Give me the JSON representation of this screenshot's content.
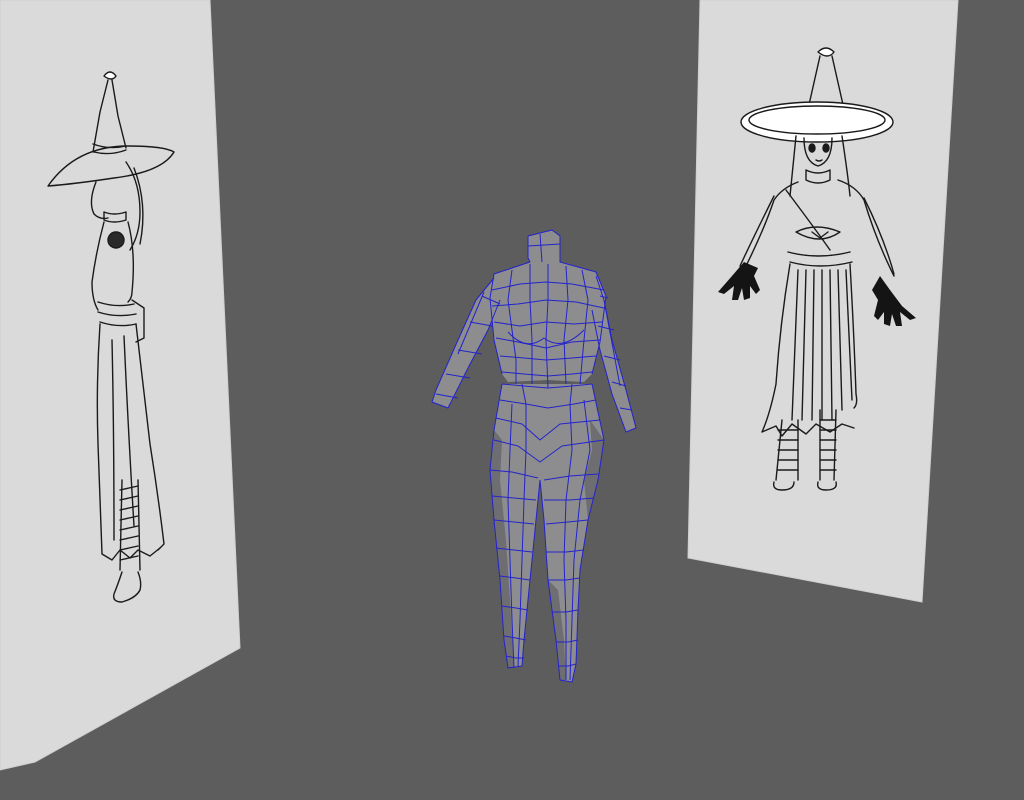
{
  "viewport": {
    "background": "#5d5d5d",
    "plane_color": "#dadada",
    "plane_edge_color": "#e6e6e6",
    "mesh_fill": "#8d8d8f",
    "mesh_shadow": "#6f6f73",
    "wireframe_color": "#1e1ed2",
    "sketch_ink": "#1a1a1a"
  },
  "scene": {
    "side_reference": {
      "icon": "side-view-sketch",
      "subject": "witch-side"
    },
    "front_reference": {
      "icon": "front-view-sketch",
      "subject": "witch-front"
    },
    "body_mesh": {
      "icon": "base-body-mesh",
      "display": "wireframe-on-shaded"
    }
  }
}
